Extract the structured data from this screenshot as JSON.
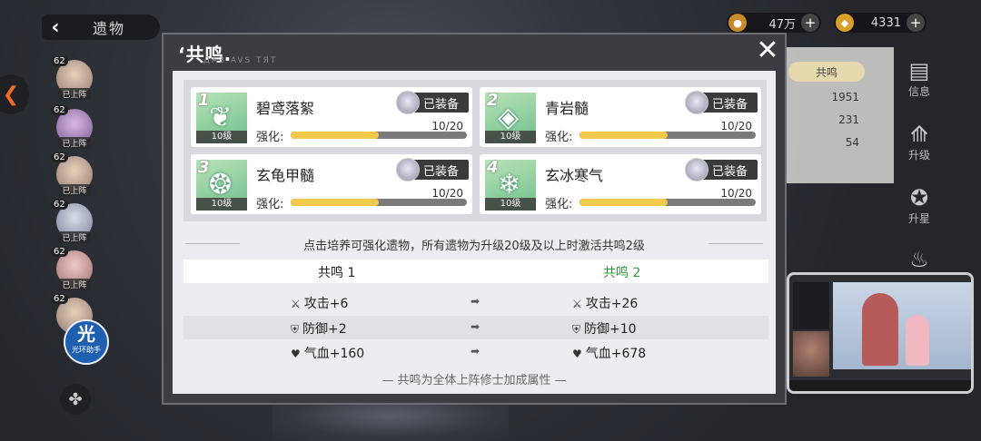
{
  "page": {
    "back_label": "遗物"
  },
  "resources": [
    {
      "icon": "coin-icon",
      "value": "47万"
    },
    {
      "icon": "spirit-stone-icon",
      "value": "4331"
    }
  ],
  "left_roster": [
    {
      "level": "62",
      "tag": "已上阵"
    },
    {
      "level": "62",
      "tag": "已上阵"
    },
    {
      "level": "62",
      "tag": "已上阵"
    },
    {
      "level": "62",
      "tag": "已上阵"
    },
    {
      "level": "62",
      "tag": "已上阵"
    },
    {
      "level": "62",
      "tag": ""
    }
  ],
  "helper": {
    "big": "光",
    "small": "光环助手"
  },
  "right_panel": {
    "tab": "共鸣",
    "stats": [
      "1951",
      "231",
      "54"
    ],
    "menu": [
      {
        "label": "信息",
        "icon": "info-icon"
      },
      {
        "label": "升级",
        "icon": "upgrade-icon"
      },
      {
        "label": "升星",
        "icon": "star-up-icon"
      }
    ]
  },
  "modal": {
    "title": "‘共鸣.",
    "subtitle": "ДАЗ AVS ТЯТ",
    "relics": [
      {
        "index": "1",
        "name": "碧鸢落絮",
        "level": "10级",
        "equip": "已装备",
        "strength_label": "强化:",
        "progress": "10/20",
        "ratio": 0.5
      },
      {
        "index": "2",
        "name": "青岩髓",
        "level": "10级",
        "equip": "已装备",
        "strength_label": "强化:",
        "progress": "10/20",
        "ratio": 0.5
      },
      {
        "index": "3",
        "name": "玄龟甲髓",
        "level": "10级",
        "equip": "已装备",
        "strength_label": "强化:",
        "progress": "10/20",
        "ratio": 0.5
      },
      {
        "index": "4",
        "name": "玄冰寒气",
        "level": "10级",
        "equip": "已装备",
        "strength_label": "强化:",
        "progress": "10/20",
        "ratio": 0.5
      }
    ],
    "hint": "点击培养可强化遗物，所有遗物为升级20级及以上时激活共鸣2级",
    "col_left": "共鸣 1",
    "col_right": "共鸣 2",
    "stats": [
      {
        "icon": "sword-icon",
        "glyph": "⚔",
        "left": "攻击+6",
        "right": "攻击+26"
      },
      {
        "icon": "shield-icon",
        "glyph": "⛨",
        "left": "防御+2",
        "right": "防御+10"
      },
      {
        "icon": "heart-icon",
        "glyph": "♥",
        "left": "气血+160",
        "right": "气血+678"
      }
    ],
    "footer": "— 共鸣为全体上阵修士加成属性 —"
  },
  "colors": {
    "active_green": "#2f9a3a",
    "progress": "#f2c94c"
  }
}
